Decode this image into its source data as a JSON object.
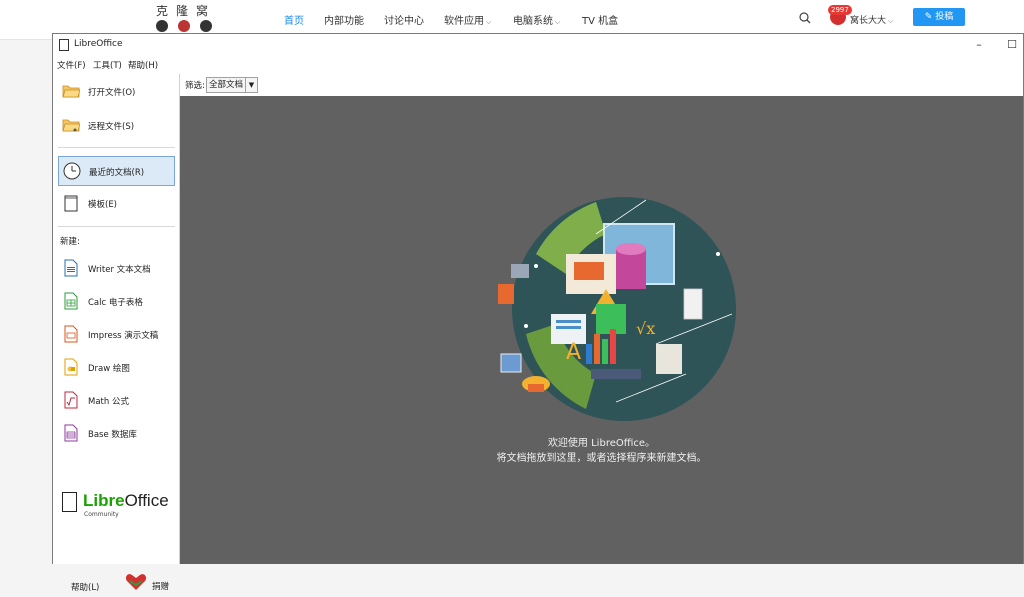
{
  "site": {
    "logo_text": "克隆窝",
    "nav": [
      {
        "label": "首页",
        "active": true
      },
      {
        "label": "内部功能",
        "active": false
      },
      {
        "label": "讨论中心",
        "active": false
      },
      {
        "label": "软件应用",
        "active": false,
        "dropdown": true
      },
      {
        "label": "电脑系统",
        "active": false,
        "dropdown": true
      },
      {
        "label": "TV 机盒",
        "active": false
      }
    ],
    "badge": "2997",
    "username": "窝长大大",
    "post_button": "投稿",
    "icons": [
      "search-icon",
      "avatar",
      "edit-icon",
      "chevron-down-icon"
    ]
  },
  "window": {
    "title": "LibreOffice",
    "minimize": "–",
    "maximize": "☐",
    "menu": [
      "文件(F)",
      "工具(T)",
      "帮助(H)"
    ]
  },
  "sidebar": {
    "open_file": "打开文件(O)",
    "remote_files": "远程文件(S)",
    "recent_docs": "最近的文档(R)",
    "templates": "模板(E)",
    "new_label": "新建:",
    "new_items": [
      {
        "label": "Writer 文本文档",
        "icon": "writer-icon",
        "color": "#2a6fb0"
      },
      {
        "label": "Calc 电子表格",
        "icon": "calc-icon",
        "color": "#2e9b3c"
      },
      {
        "label": "Impress 演示文稿",
        "icon": "impress-icon",
        "color": "#d9541e"
      },
      {
        "label": "Draw 绘图",
        "icon": "draw-icon",
        "color": "#e0a100"
      },
      {
        "label": "Math 公式",
        "icon": "math-icon",
        "color": "#c0263b"
      },
      {
        "label": "Base 数据库",
        "icon": "base-icon",
        "color": "#8e3a9e"
      }
    ],
    "brand_libre": "Libre",
    "brand_office": "Office",
    "brand_community": "Community",
    "help": "帮助(L)",
    "donate": "捐赠"
  },
  "main": {
    "filter_label": "筛选:",
    "filter_value": "全部文档",
    "welcome_line1": "欢迎使用 LibreOffice。",
    "welcome_line2": "将文档拖放到这里，或者选择程序来新建文档。",
    "background_color": "#616161"
  }
}
